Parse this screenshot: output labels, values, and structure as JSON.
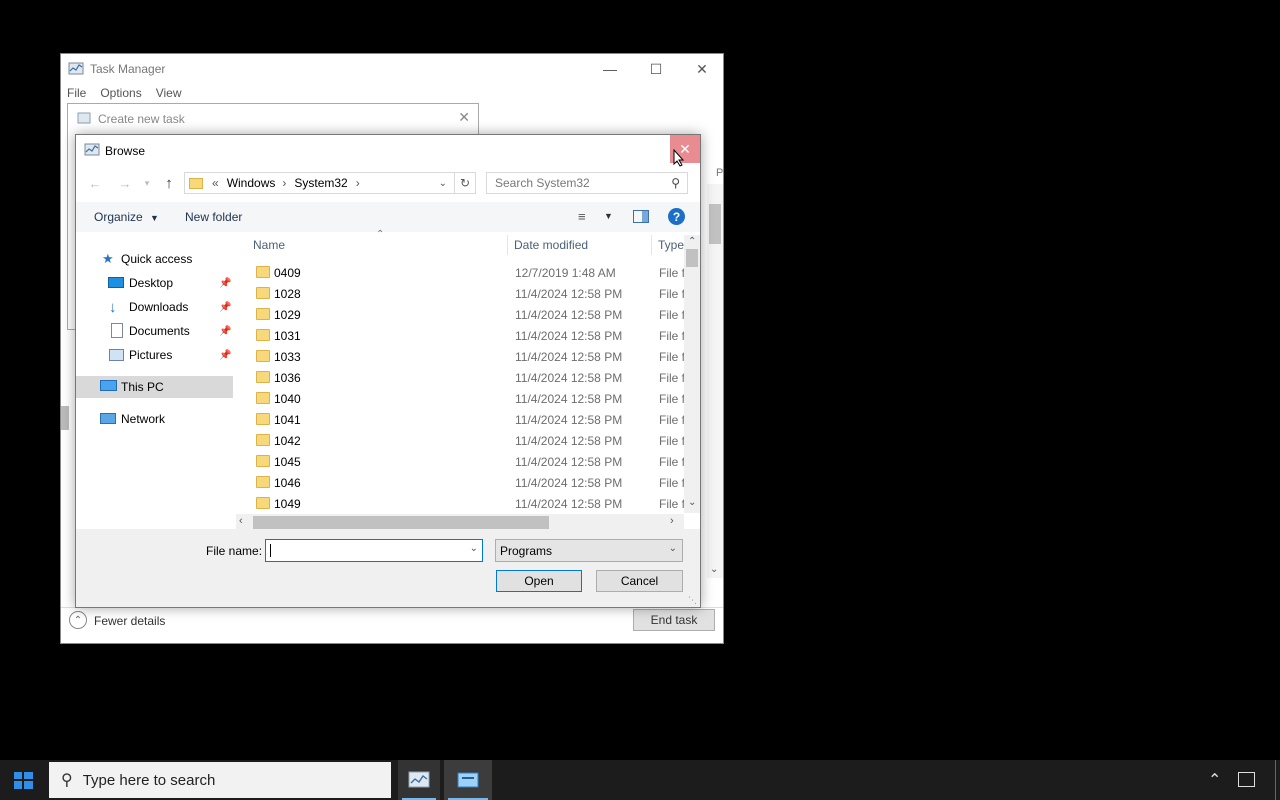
{
  "task_manager": {
    "title": "Task Manager",
    "menu": [
      "File",
      "Options",
      "View"
    ],
    "fewer_details": "Fewer details",
    "end_task": "End task",
    "controls": {
      "minimize": "—",
      "maximize": "☐",
      "close": "✕"
    },
    "partial_header": "P"
  },
  "create_new_task": {
    "title": "Create new task",
    "close": "✕"
  },
  "browse": {
    "title": "Browse",
    "close": "✕",
    "breadcrumb": [
      "«",
      "Windows",
      "System32"
    ],
    "search_placeholder": "Search System32",
    "toolbar": {
      "organize": "Organize",
      "new_folder": "New folder"
    },
    "nav": [
      {
        "label": "Quick access",
        "icon": "star-icon"
      },
      {
        "label": "Desktop",
        "icon": "desktop-icon",
        "pinned": true
      },
      {
        "label": "Downloads",
        "icon": "download-icon",
        "pinned": true
      },
      {
        "label": "Documents",
        "icon": "document-icon",
        "pinned": true
      },
      {
        "label": "Pictures",
        "icon": "pictures-icon",
        "pinned": true
      },
      {
        "label": "This PC",
        "icon": "computer-icon",
        "selected": true
      },
      {
        "label": "Network",
        "icon": "network-icon"
      }
    ],
    "columns": {
      "name": "Name",
      "date": "Date modified",
      "type": "Type"
    },
    "rows": [
      {
        "name": "0409",
        "date": "12/7/2019 1:48 AM",
        "type": "File f"
      },
      {
        "name": "1028",
        "date": "11/4/2024 12:58 PM",
        "type": "File f"
      },
      {
        "name": "1029",
        "date": "11/4/2024 12:58 PM",
        "type": "File f"
      },
      {
        "name": "1031",
        "date": "11/4/2024 12:58 PM",
        "type": "File f"
      },
      {
        "name": "1033",
        "date": "11/4/2024 12:58 PM",
        "type": "File f"
      },
      {
        "name": "1036",
        "date": "11/4/2024 12:58 PM",
        "type": "File f"
      },
      {
        "name": "1040",
        "date": "11/4/2024 12:58 PM",
        "type": "File f"
      },
      {
        "name": "1041",
        "date": "11/4/2024 12:58 PM",
        "type": "File f"
      },
      {
        "name": "1042",
        "date": "11/4/2024 12:58 PM",
        "type": "File f"
      },
      {
        "name": "1045",
        "date": "11/4/2024 12:58 PM",
        "type": "File f"
      },
      {
        "name": "1046",
        "date": "11/4/2024 12:58 PM",
        "type": "File f"
      },
      {
        "name": "1049",
        "date": "11/4/2024 12:58 PM",
        "type": "File f"
      }
    ],
    "file_name_label": "File name:",
    "file_name_value": "",
    "file_type": "Programs",
    "open": "Open",
    "cancel": "Cancel"
  },
  "taskbar": {
    "search_placeholder": "Type here to search"
  },
  "colors": {
    "close_hover": "#e88c91",
    "selection": "#d9d9d9",
    "folder": "#f7d97b",
    "accent": "#0078d7"
  }
}
